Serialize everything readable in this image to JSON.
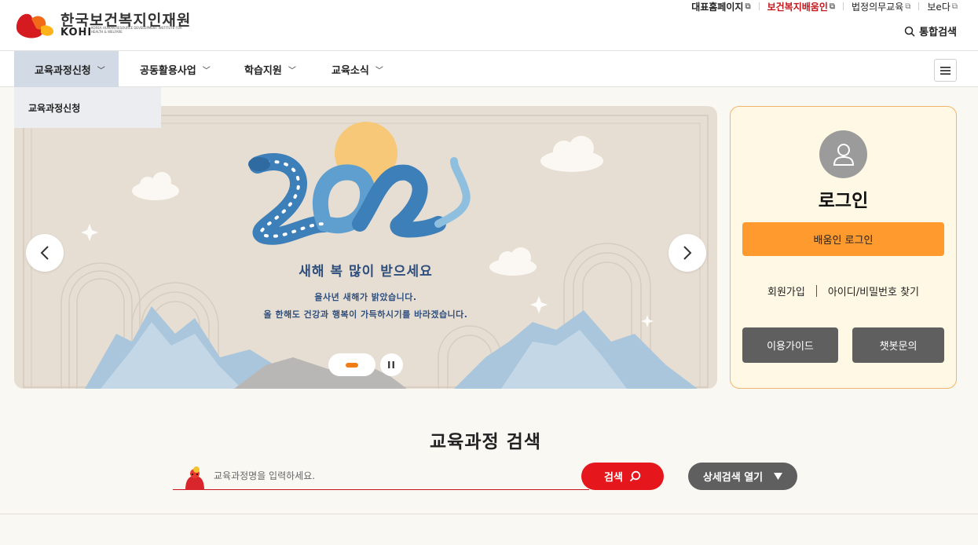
{
  "header": {
    "logo_kr": "한국보건복지인재원",
    "logo_en": "KOHI",
    "logo_sub": "KOREA HUMAN RESOURCE DEVELOPMENT INSTITUTE FOR HEALTH & WELFARE",
    "util_links": [
      "대표홈페이지",
      "보건복지배움인",
      "법정의무교육",
      "보e다"
    ],
    "search_label": "통합검색"
  },
  "gnb": {
    "items": [
      "교육과정신청",
      "공동활용사업",
      "학습지원",
      "교육소식"
    ],
    "submenu": [
      "교육과정신청"
    ]
  },
  "banner": {
    "year_text": "2025",
    "title": "새해 복 많이 받으세요",
    "line1": "을사년 새해가 밝았습니다.",
    "line2": "올 한해도 건강과 행복이 가득하시기를 바라겠습니다.",
    "pause_label": "II"
  },
  "login": {
    "title": "로그인",
    "login_button": "배움인 로그인",
    "join": "회원가입",
    "find": "아이디/비밀번호 찾기",
    "guide": "이용가이드",
    "chatbot": "챗봇문의"
  },
  "course_search": {
    "title": "교육과정 검색",
    "placeholder": "교육과정명을 입력하세요.",
    "search_button": "검색",
    "detail_button": "상세검색 열기"
  },
  "colors": {
    "brand_red": "#c4161c",
    "orange": "#ff9a2e",
    "gnb_active": "#d2dae5",
    "login_bg": "#fff8e4"
  }
}
